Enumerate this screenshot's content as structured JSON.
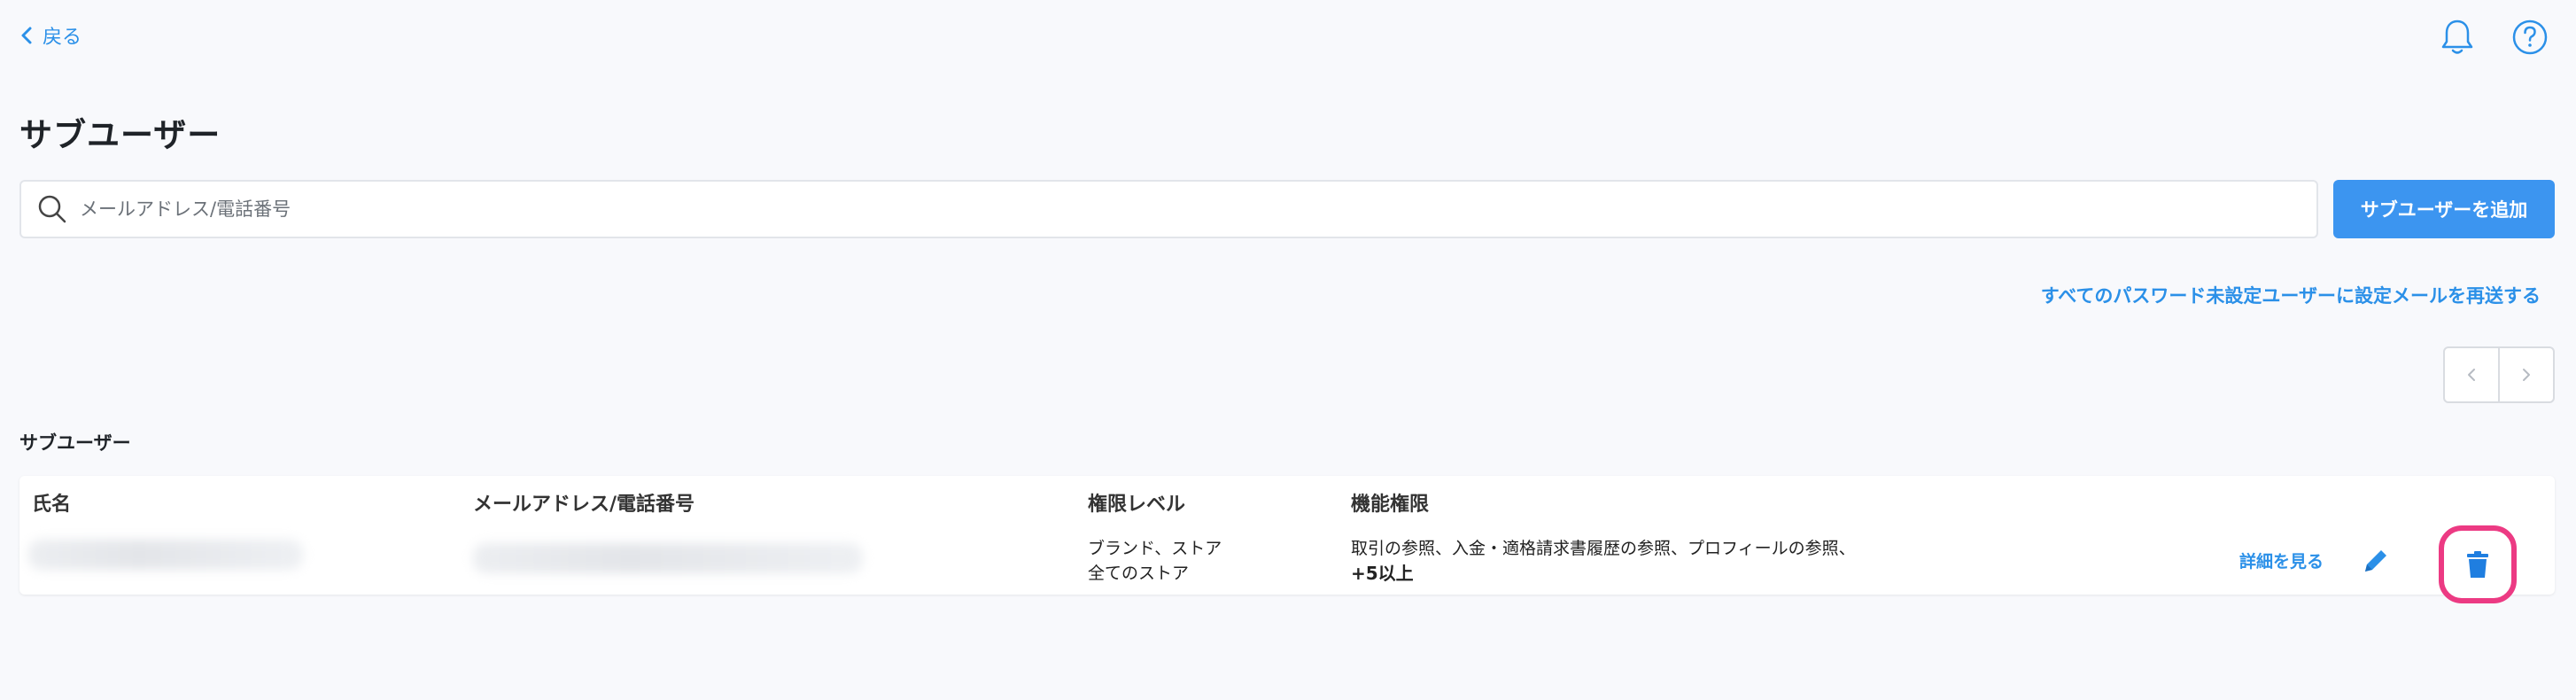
{
  "header": {
    "back_label": "戻る",
    "page_title": "サブユーザー"
  },
  "search": {
    "placeholder": "メールアドレス/電話番号",
    "value": ""
  },
  "actions": {
    "add_subuser_label": "サブユーザーを追加",
    "resend_link_label": "すべてのパスワード未設定ユーザーに設定メールを再送する"
  },
  "pagination": {
    "prev_symbol": "‹",
    "next_symbol": "›"
  },
  "section": {
    "label": "サブユーザー"
  },
  "table": {
    "columns": [
      "氏名",
      "メールアドレス/電話番号",
      "権限レベル",
      "機能権限"
    ],
    "rows": [
      {
        "name": "",
        "contact": "",
        "permission_level_line1": "ブランド、ストア",
        "permission_level_line2": "全てのストア",
        "feature_permissions_line1": "取引の参照、入金・適格請求書履歴の参照、プロフィールの参照、",
        "feature_permissions_more": "+5以上",
        "details_label": "詳細を見る"
      }
    ]
  },
  "icons": {
    "back": "chevron-left-icon",
    "notification": "bell-icon",
    "help": "help-circle-icon",
    "search": "search-icon",
    "edit": "pencil-icon",
    "delete": "trash-icon"
  },
  "colors": {
    "accent": "#3c95f0",
    "link": "#2b90e8",
    "delete_highlight": "#ec3a83",
    "background": "#f8f9fc"
  }
}
